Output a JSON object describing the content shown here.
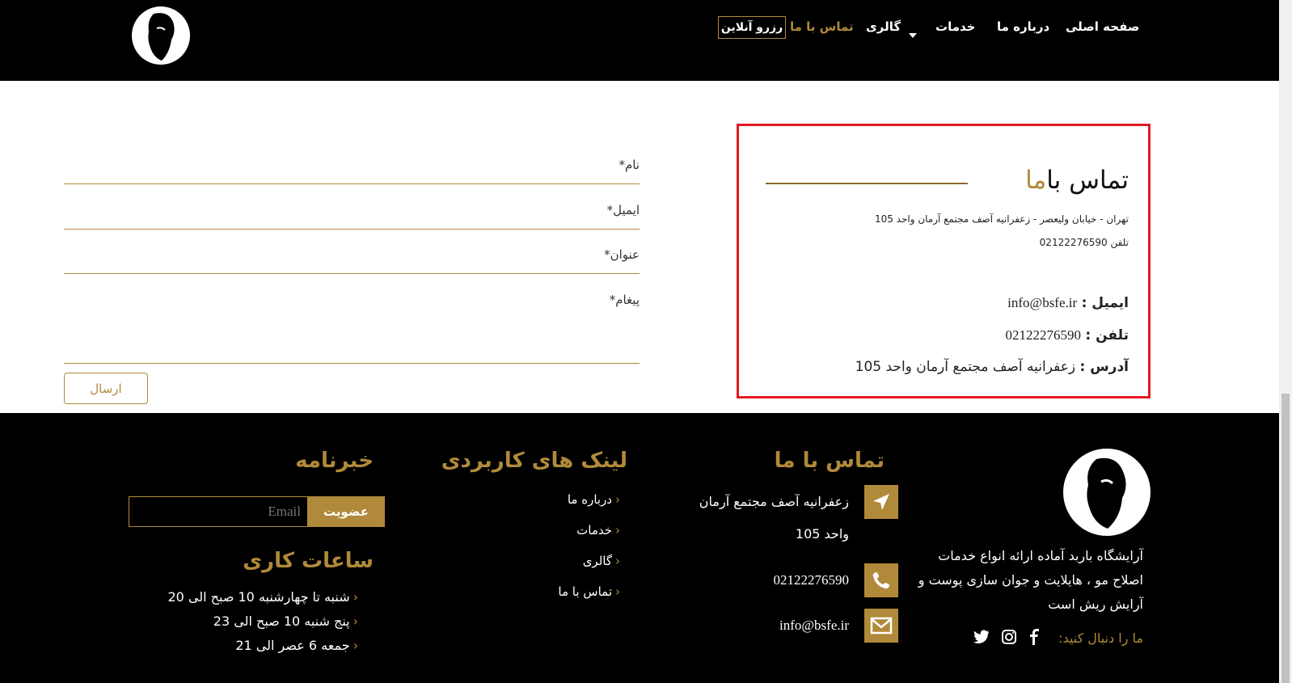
{
  "header": {
    "nav": [
      "صفحه اصلی",
      "درباره ما",
      "خدمات",
      "گالری",
      "تماس با ما"
    ],
    "reserve_label": "رزرو آنلاین"
  },
  "contact_box": {
    "title_main": "تماس با",
    "title_accent": "ما",
    "address_line": "تهران - خیابان ولیعصر - زعفرانیه آصف مجتمع آرمان واحد 105",
    "phone_line": "تلفن 02122276590",
    "email_label": "ایمیل :",
    "email_value": "info@bsfe.ir",
    "phone_label": "تلفن :",
    "phone_value": "02122276590",
    "address_label": "آدرس :",
    "address_value": "زعفرانیه آصف مجتمع آرمان واحد 105"
  },
  "form": {
    "name": "نام*",
    "email": "ایمیل*",
    "subject": "عنوان*",
    "message": "پیغام*",
    "send": "ارسال"
  },
  "footer": {
    "about_lines": [
      "آرایشگاه باربد آماده ارائه انواع خدمات",
      "اصلاح مو ، هایلایت و جوان سازی پوست و",
      "آرایش ریش است"
    ],
    "follow_label": "ما را دنبال کنید:",
    "contact_title": "تماس با ما",
    "contact_address_1": "زعفرانیه آصف مجتمع آرمان",
    "contact_address_2": "واحد 105",
    "contact_phone": "02122276590",
    "contact_email": "info@bsfe.ir",
    "links_title": "لینک های کاربردی",
    "links": [
      "درباره ما",
      "خدمات",
      "گالری",
      "تماس با ما"
    ],
    "newsletter_title": "خبرنامه",
    "newsletter_placeholder": "Email",
    "newsletter_button": "عضویت",
    "hours_title": "ساعات کاری",
    "hours": [
      "شنبه تا چهارشنبه 10 صبح الی 20",
      "پنج شنبه 10 صبح الی 23",
      "جمعه 6 عصر الی 21"
    ]
  },
  "colors": {
    "accent": "#b08a3a",
    "highlight_border": "#e11b22"
  },
  "icons": [
    "barber-logo-icon",
    "location-icon",
    "phone-icon",
    "mail-icon",
    "facebook-icon",
    "instagram-icon",
    "twitter-icon",
    "chevron-icon"
  ]
}
